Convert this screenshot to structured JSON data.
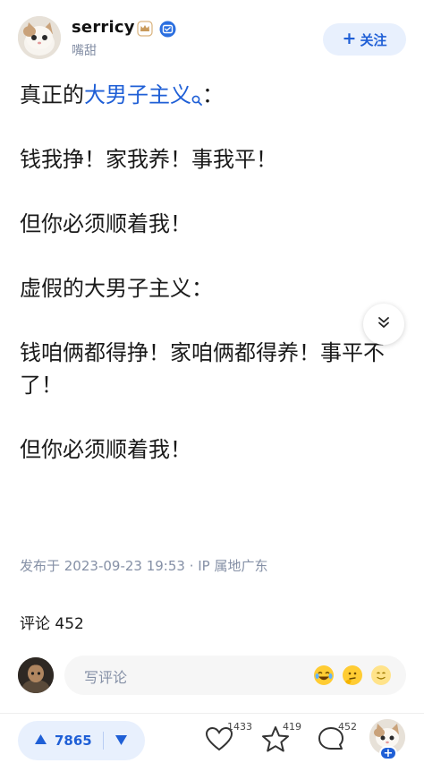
{
  "author": {
    "name": "serricy",
    "subtitle": "嘴甜",
    "follow_label": "关注",
    "follow_icon": "+"
  },
  "post": {
    "title_prefix": "真正的",
    "title_keyword": "大男子主义",
    "title_suffix": "：",
    "lines": [
      "钱我挣！家我养！事我平！",
      "但你必须顺着我！",
      "虚假的大男子主义：",
      "钱咱俩都得挣！家咱俩都得养！事平不了！",
      "但你必须顺着我！"
    ]
  },
  "meta": {
    "published": "发布于 2023-09-23 19:53 · IP 属地广东"
  },
  "comments": {
    "title": "评论 452",
    "input_placeholder": "写评论"
  },
  "bottom_bar": {
    "upvotes": "7865",
    "like_count": "1433",
    "favorite_count": "419",
    "comment_count": "452",
    "add_label": "+"
  },
  "colors": {
    "accent": "#1f5fd6",
    "accent_bg": "#e8f0fd",
    "muted": "#8590a6"
  },
  "icons": [
    "crown-badge-icon",
    "verified-badge-icon",
    "search-icon",
    "chevron-double-down-icon",
    "upvote-arrow-icon",
    "downvote-arrow-icon",
    "heart-icon",
    "star-icon",
    "comment-bubble-icon",
    "laugh-emoji-icon",
    "thinking-emoji-icon",
    "smile-emoji-icon"
  ]
}
